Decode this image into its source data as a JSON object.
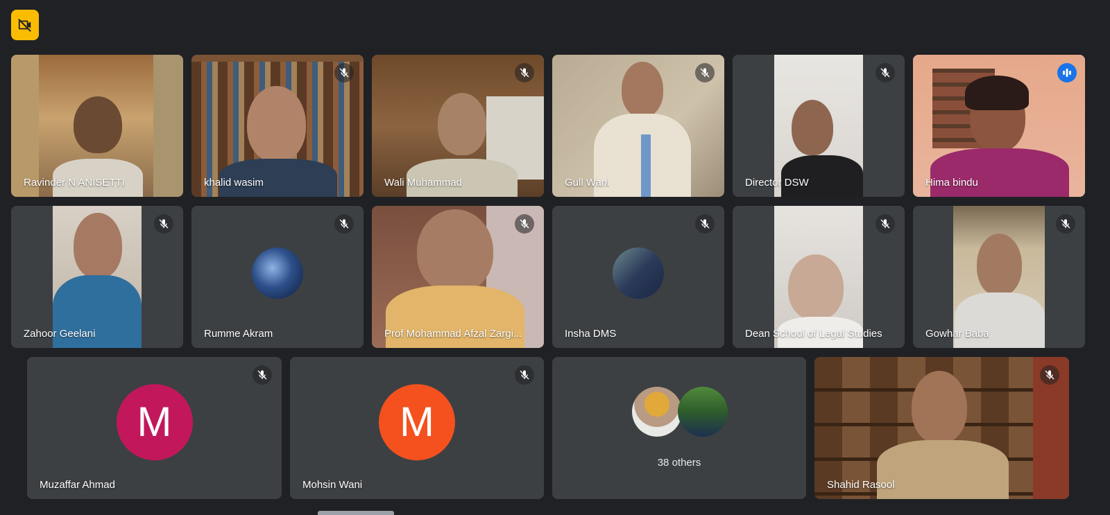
{
  "colors": {
    "background": "#202124",
    "tile": "#3c4043",
    "badge": "#fbbc04",
    "active_outline": "#8ab4f8",
    "speaking_indicator": "#1a73e8"
  },
  "top_badge": {
    "icon": "video-off-icon"
  },
  "participants": [
    {
      "name": "Ravinder N ANISETTI",
      "muted": false
    },
    {
      "name": "khalid wasim",
      "muted": true
    },
    {
      "name": "Wali Muhammad",
      "muted": true
    },
    {
      "name": "Gull Wani",
      "muted": true
    },
    {
      "name": "Director DSW",
      "muted": true
    },
    {
      "name": "Hima bindu",
      "muted": false,
      "speaking": true
    },
    {
      "name": "Zahoor Geelani",
      "muted": true
    },
    {
      "name": "Rumme Akram",
      "muted": true
    },
    {
      "name": "Prof Mohammad Afzal Zargi...",
      "muted": true
    },
    {
      "name": "Insha DMS",
      "muted": true
    },
    {
      "name": "Dean School of Legal Studies",
      "muted": true
    },
    {
      "name": "Gowhar Baba",
      "muted": true
    },
    {
      "name": "Muzaffar Ahmad",
      "muted": true,
      "avatar_letter": "M",
      "avatar_color": "#c2185b"
    },
    {
      "name": "Mohsin Wani",
      "muted": true,
      "avatar_letter": "M",
      "avatar_color": "#f4511e"
    },
    {
      "name": "Shahid Rasool",
      "muted": true
    }
  ],
  "others": {
    "label": "38 others"
  }
}
